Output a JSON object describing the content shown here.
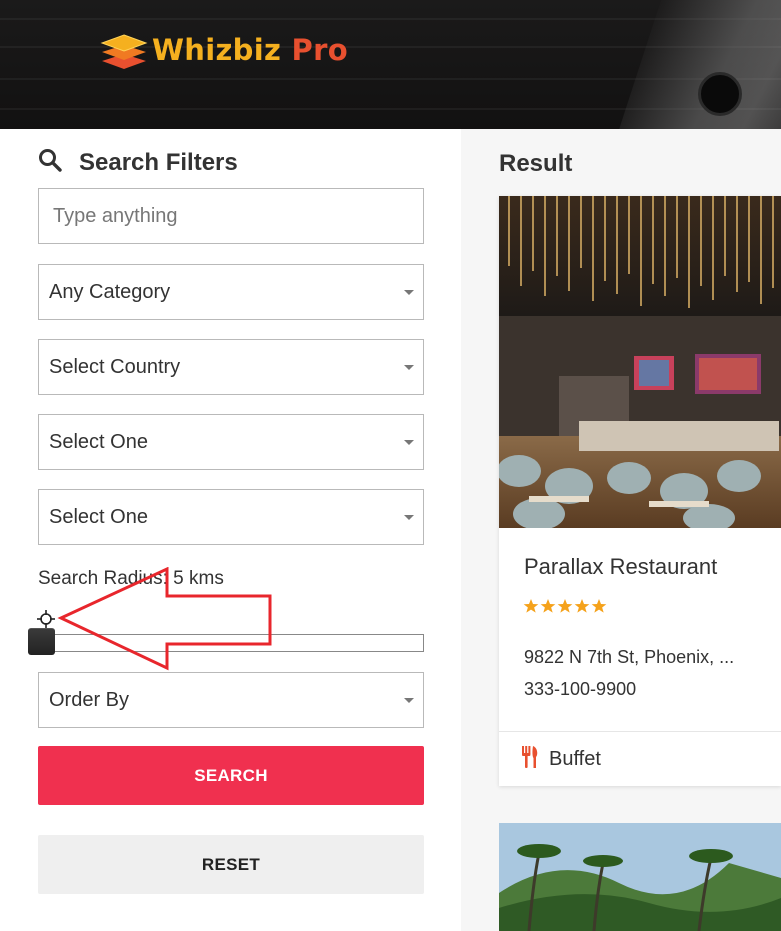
{
  "header": {
    "logo_word": "Whizbiz",
    "logo_suffix": "Pro",
    "colors": {
      "logo_yellow": "#f5b01f",
      "logo_orange": "#e8502f"
    }
  },
  "filters": {
    "title": "Search Filters",
    "icon": "search-icon",
    "keyword_placeholder": "Type anything",
    "category": "Any Category",
    "country": "Select Country",
    "select_one_a": "Select One",
    "select_one_b": "Select One",
    "radius_label": "Search Radius: 5 kms",
    "order_by": "Order By",
    "search_label": "SEARCH",
    "reset_label": "RESET",
    "colors": {
      "search_button": "#f0304f",
      "reset_button": "#efefef"
    }
  },
  "results": {
    "title": "Result",
    "listings": [
      {
        "name": "Parallax Restaurant",
        "rating": 5,
        "address": "9822 N 7th St, Phoenix, ...",
        "phone": "333-100-9900",
        "category": "Buffet",
        "category_icon": "fork-knife-icon"
      }
    ],
    "colors": {
      "star": "#f5a21b",
      "category_icon": "#e8502f"
    }
  }
}
